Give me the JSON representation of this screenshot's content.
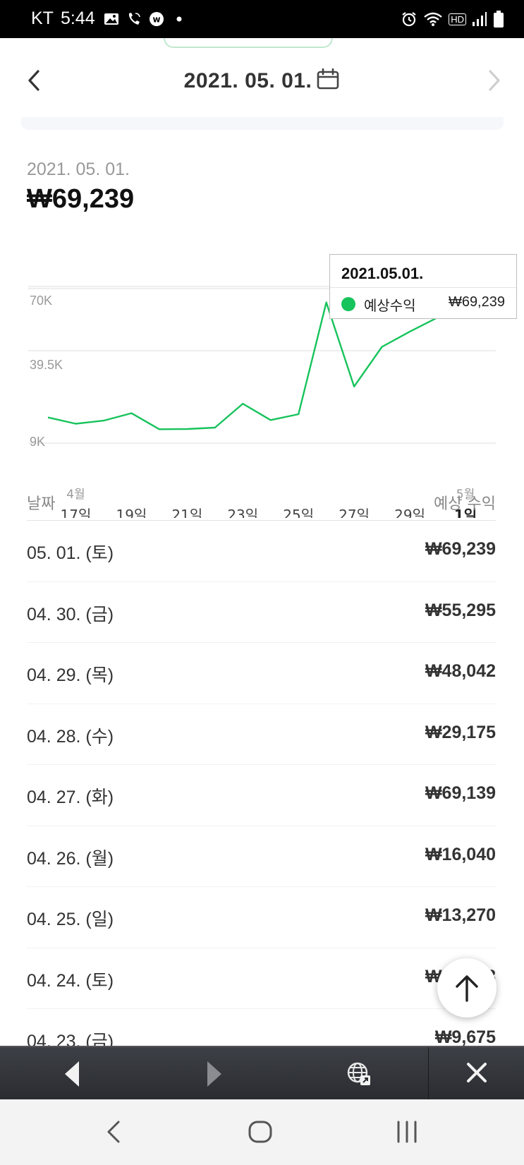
{
  "status": {
    "carrier": "KT",
    "time": "5:44",
    "hd_label": "HD"
  },
  "date_nav": {
    "title": "2021. 05. 01."
  },
  "summary": {
    "date": "2021. 05. 01.",
    "amount": "₩69,239"
  },
  "tooltip": {
    "title": "2021.05.01.",
    "label": "예상수익",
    "value": "₩69,239"
  },
  "colors": {
    "line": "#17c35c",
    "grid": "#e8e8e8",
    "axis_text": "#999999"
  },
  "chart_data": {
    "type": "line",
    "x": [
      "04.16",
      "04.17",
      "04.18",
      "04.19",
      "04.20",
      "04.21",
      "04.22",
      "04.23",
      "04.24",
      "04.25",
      "04.26",
      "04.27",
      "04.28",
      "04.29",
      "04.30",
      "05.01"
    ],
    "series": [
      {
        "values": [
          14500,
          11500,
          13000,
          16500,
          8900,
          9000,
          9675,
          21028,
          13270,
          16040,
          69139,
          29175,
          48042,
          55295,
          62000,
          69239
        ]
      }
    ],
    "y_ticks": [
      {
        "value": 70000,
        "label": "70K"
      },
      {
        "value": 39500,
        "label": "39.5K"
      },
      {
        "value": 9000,
        "label": "9K"
      }
    ],
    "x_ticks": [
      {
        "index": 1,
        "label": "17일",
        "sub": "4월"
      },
      {
        "index": 3,
        "label": "19일",
        "sub": ""
      },
      {
        "index": 5,
        "label": "21일",
        "sub": ""
      },
      {
        "index": 7,
        "label": "23일",
        "sub": ""
      },
      {
        "index": 9,
        "label": "25일",
        "sub": ""
      },
      {
        "index": 11,
        "label": "27일",
        "sub": ""
      },
      {
        "index": 13,
        "label": "29일",
        "sub": ""
      },
      {
        "index": 15,
        "label": "1일",
        "sub": "5월"
      }
    ],
    "ylim": [
      3500,
      73000
    ],
    "grid": true
  },
  "table": {
    "header_date": "날짜",
    "header_value": "예상 수익",
    "rows": [
      {
        "date": "05. 01. (토)",
        "value": "₩69,239"
      },
      {
        "date": "04. 30. (금)",
        "value": "₩55,295"
      },
      {
        "date": "04. 29. (목)",
        "value": "₩48,042"
      },
      {
        "date": "04. 28. (수)",
        "value": "₩29,175"
      },
      {
        "date": "04. 27. (화)",
        "value": "₩69,139"
      },
      {
        "date": "04. 26. (월)",
        "value": "₩16,040"
      },
      {
        "date": "04. 25. (일)",
        "value": "₩13,270"
      },
      {
        "date": "04. 24. (토)",
        "value": "₩21,028"
      },
      {
        "date": "04. 23. (금)",
        "value": "₩9,675"
      }
    ]
  }
}
